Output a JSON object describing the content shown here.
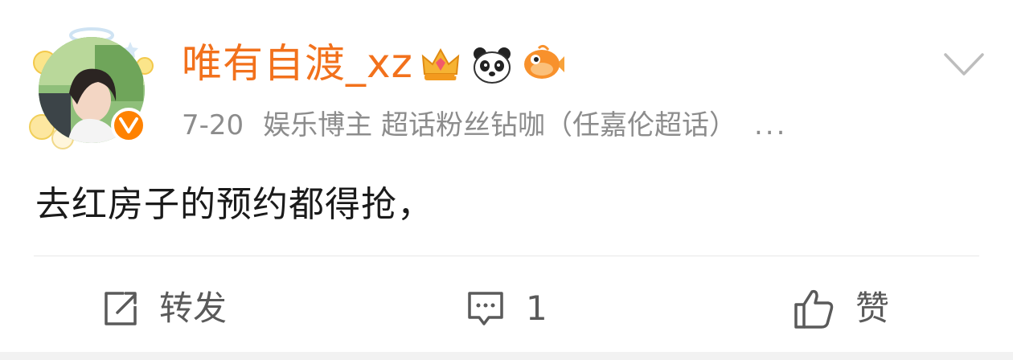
{
  "post": {
    "username": "唯有自渡_xz",
    "time": "7-20",
    "source": "娱乐博主 超话粉丝钻咖（任嘉伦超话）",
    "more": "...",
    "text": "去红房子的预约都得抢，"
  },
  "badges": [
    {
      "icon": "crown-membership-icon"
    },
    {
      "icon": "panda-icon"
    },
    {
      "icon": "orange-fish-icon"
    }
  ],
  "actions": {
    "repost_label": "转发",
    "comment_count": "1",
    "like_label": "赞"
  },
  "colors": {
    "username": "#f2711c",
    "verified_badge": "#ff8200",
    "meta_text": "#8c8c8c",
    "body_text": "#1a1a1a",
    "action_text": "#5a5a5a"
  }
}
